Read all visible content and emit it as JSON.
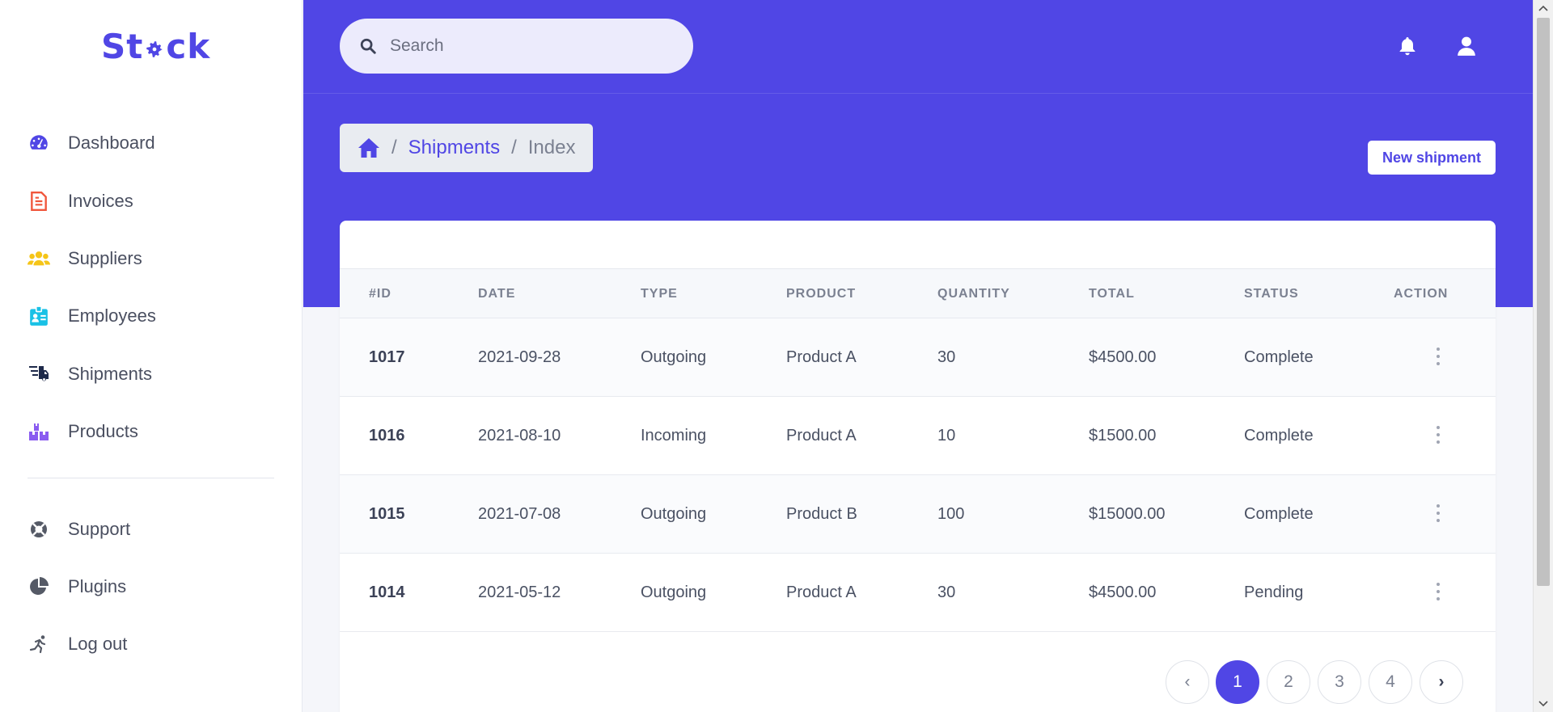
{
  "app": {
    "logo_text_start": "St",
    "logo_text_end": "ck",
    "brand_color": "#5046e5"
  },
  "sidebar": {
    "items": [
      {
        "label": "Dashboard",
        "icon": "gauge-icon",
        "color": "#5046e5"
      },
      {
        "label": "Invoices",
        "icon": "invoice-icon",
        "color": "#f0563c"
      },
      {
        "label": "Suppliers",
        "icon": "users-icon",
        "color": "#f5c518"
      },
      {
        "label": "Employees",
        "icon": "id-card-icon",
        "color": "#19c1e6"
      },
      {
        "label": "Shipments",
        "icon": "truck-icon",
        "color": "#1e2a4a"
      },
      {
        "label": "Products",
        "icon": "boxes-icon",
        "color": "#8a5cf0"
      }
    ],
    "secondary": [
      {
        "label": "Support",
        "icon": "lifebuoy-icon"
      },
      {
        "label": "Plugins",
        "icon": "pie-chart-icon"
      },
      {
        "label": "Log out",
        "icon": "running-icon"
      }
    ]
  },
  "header": {
    "search_placeholder": "Search",
    "icons": [
      "bell-icon",
      "user-icon"
    ]
  },
  "breadcrumb": {
    "home_icon": "home-icon",
    "section": "Shipments",
    "current": "Index",
    "separator": "/"
  },
  "actions": {
    "new_shipment": "New shipment"
  },
  "table": {
    "columns": [
      "#ID",
      "DATE",
      "TYPE",
      "PRODUCT",
      "QUANTITY",
      "TOTAL",
      "STATUS",
      "ACTION"
    ],
    "rows": [
      {
        "id": "1017",
        "date": "2021-09-28",
        "type": "Outgoing",
        "product": "Product A",
        "quantity": "30",
        "total": "$4500.00",
        "status": "Complete"
      },
      {
        "id": "1016",
        "date": "2021-08-10",
        "type": "Incoming",
        "product": "Product A",
        "quantity": "10",
        "total": "$1500.00",
        "status": "Complete"
      },
      {
        "id": "1015",
        "date": "2021-07-08",
        "type": "Outgoing",
        "product": "Product B",
        "quantity": "100",
        "total": "$15000.00",
        "status": "Complete"
      },
      {
        "id": "1014",
        "date": "2021-05-12",
        "type": "Outgoing",
        "product": "Product A",
        "quantity": "30",
        "total": "$4500.00",
        "status": "Pending"
      }
    ]
  },
  "pagination": {
    "prev": "‹",
    "pages": [
      "1",
      "2",
      "3",
      "4"
    ],
    "current": "1",
    "next": "›"
  }
}
